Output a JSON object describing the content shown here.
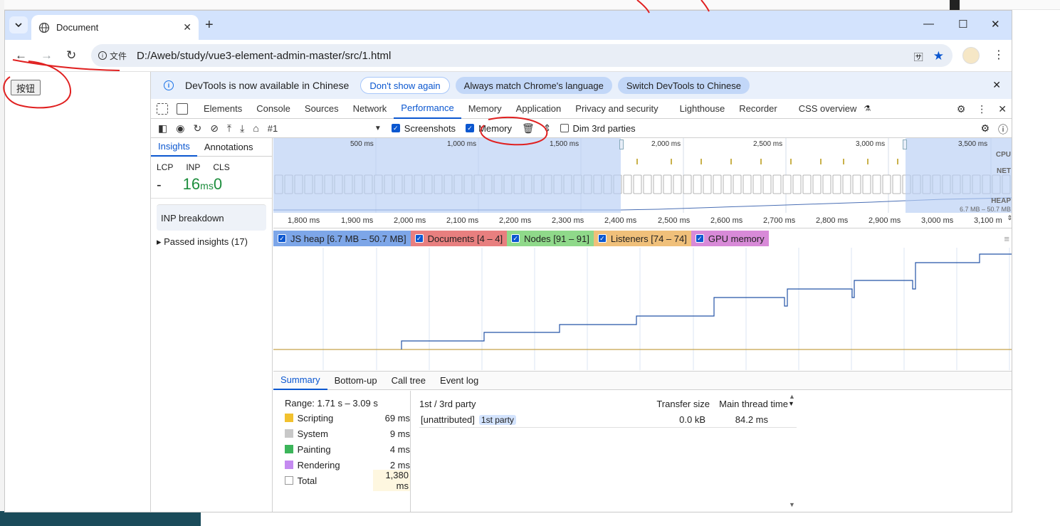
{
  "browser": {
    "tab_title": "Document",
    "address_prefix": "文件",
    "url": "D:/Aweb/study/vue3-element-admin-master/src/1.html"
  },
  "page": {
    "button_label": "按钮"
  },
  "infobar": {
    "message": "DevTools is now available in Chinese",
    "btn_dont_show": "Don't show again",
    "btn_match": "Always match Chrome's language",
    "btn_switch": "Switch DevTools to Chinese"
  },
  "devtools_tabs": [
    "Elements",
    "Console",
    "Sources",
    "Network",
    "Performance",
    "Memory",
    "Application",
    "Privacy and security",
    "Lighthouse",
    "Recorder",
    "CSS overview"
  ],
  "perf_toolbar": {
    "recording": "#1",
    "screenshots": "Screenshots",
    "memory": "Memory",
    "dim": "Dim 3rd parties"
  },
  "sidebar": {
    "tab_insights": "Insights",
    "tab_annotations": "Annotations",
    "lcp": "LCP",
    "inp": "INP",
    "cls": "CLS",
    "lcp_val": "-",
    "inp_num": "16",
    "inp_unit": "ms",
    "cls_val": "0",
    "inp_breakdown": "INP breakdown",
    "passed": "Passed insights (17)"
  },
  "overview": {
    "ticks": [
      "500 ms",
      "1,000 ms",
      "1,500 ms",
      "2,000 ms",
      "2,500 ms",
      "3,000 ms",
      "3,500 ms"
    ],
    "cpu": "CPU",
    "net": "NET",
    "heap": "HEAP",
    "heap_range": "6.7 MB – 50.7 MB"
  },
  "ruler": [
    "1,800 ms",
    "1,900 ms",
    "2,000 ms",
    "2,100 ms",
    "2,200 ms",
    "2,300 ms",
    "2,400 ms",
    "2,500 ms",
    "2,600 ms",
    "2,700 ms",
    "2,800 ms",
    "2,900 ms",
    "3,000 ms",
    "3,100 m"
  ],
  "legend": [
    {
      "label": "JS heap [6.7 MB – 50.7 MB]",
      "color": "#7da6e8"
    },
    {
      "label": "Documents [4 – 4]",
      "color": "#e87f7f"
    },
    {
      "label": "Nodes [91 – 91]",
      "color": "#8fd98a"
    },
    {
      "label": "Listeners [74 – 74]",
      "color": "#f0c07a"
    },
    {
      "label": "GPU memory",
      "color": "#d88ad8"
    }
  ],
  "bottom_tabs": [
    "Summary",
    "Bottom-up",
    "Call tree",
    "Event log"
  ],
  "summary": {
    "range": "Range: 1.71 s – 3.09 s",
    "rows": [
      {
        "label": "Scripting",
        "value": "69 ms",
        "color": "#f2c12e"
      },
      {
        "label": "System",
        "value": "9 ms",
        "color": "#c8c8c8"
      },
      {
        "label": "Painting",
        "value": "4 ms",
        "color": "#3cb55a"
      },
      {
        "label": "Rendering",
        "value": "2 ms",
        "color": "#c48af0"
      },
      {
        "label": "Total",
        "value": "1,380 ms",
        "color": "#ffffff"
      }
    ],
    "col_party": "1st / 3rd party",
    "col_transfer": "Transfer size",
    "col_main": "Main thread time",
    "row_name": "[unattributed]",
    "row_party": "1st party",
    "row_transfer": "0.0 kB",
    "row_main": "84.2 ms"
  }
}
